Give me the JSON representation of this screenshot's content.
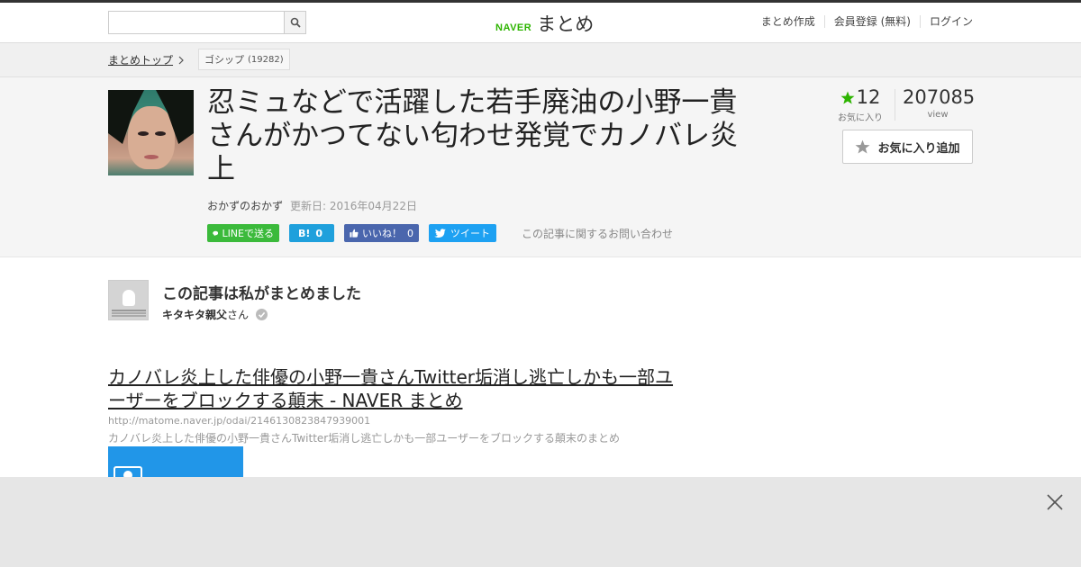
{
  "header": {
    "search_placeholder": "",
    "logo_naver": "NAVER",
    "logo_matome": "まとめ",
    "links": [
      "まとめ作成",
      "会員登録 (無料)",
      "ログイン"
    ]
  },
  "breadcrumb": {
    "home": "まとめトップ",
    "tag": "ゴシップ",
    "tag_count": "(19282)"
  },
  "article": {
    "title": "忍ミュなどで活躍した若手廃油の小野一貴さんがかつてない匂わせ発覚でカノバレ炎上",
    "author": "おかずのおかず",
    "updated": "更新日: 2016年04月22日",
    "favorites": "12",
    "favorites_label": "お気に入り",
    "views": "207085",
    "views_label": "view",
    "fav_button": "お気に入り追加"
  },
  "share": {
    "line": "LINEで送る",
    "hatena_icon": "B!",
    "hatena_count": "0",
    "facebook": "いいね！",
    "facebook_count": "0",
    "tweet": "ツイート",
    "contact": "この記事に関するお問い合わせ"
  },
  "curator": {
    "heading": "この記事は私がまとめました",
    "name": "キタキタ親父",
    "suffix": "さん"
  },
  "link": {
    "title": "カノバレ炎上した俳優の小野一貴さんTwitter垢消し逃亡しかも一部ユーザーをブロックする顛末 - NAVER まとめ",
    "url": "http://matome.naver.jp/odai/2146130823847939001",
    "description": "カノバレ炎上した俳優の小野一貴さんTwitter垢消し逃亡しかも一部ユーザーをブロックする顛末のまとめ"
  },
  "colors": {
    "brand_green": "#2db400",
    "line_green": "#3bba3b",
    "hatena_blue": "#1fa0dc",
    "facebook_blue": "#4a66ad",
    "twitter_blue": "#1da1f2",
    "star_green": "#2db400"
  }
}
